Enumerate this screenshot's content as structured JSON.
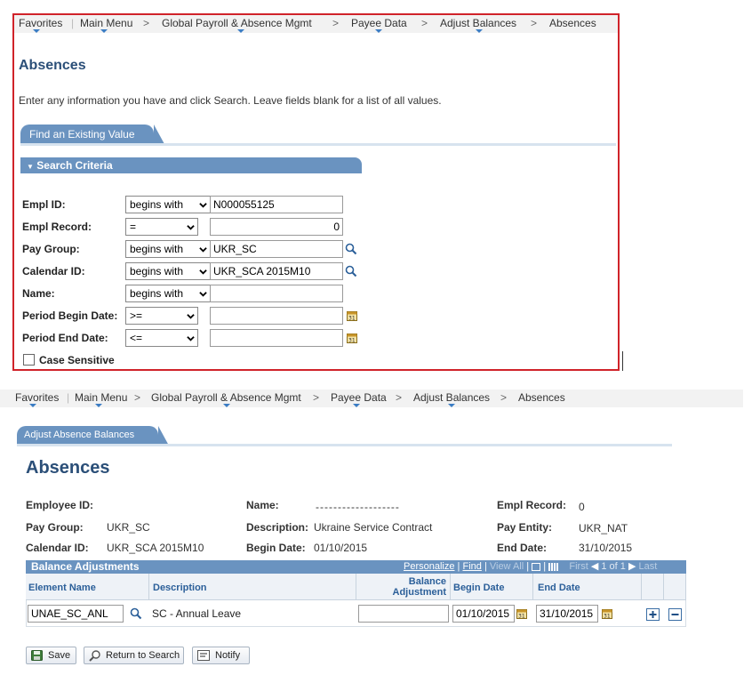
{
  "breadcrumb": {
    "favorites": "Favorites",
    "main_menu": "Main Menu",
    "global_payroll": "Global Payroll & Absence Mgmt",
    "payee_data": "Payee Data",
    "adjust_balances": "Adjust Balances",
    "absences": "Absences",
    "sep": ">"
  },
  "search_page": {
    "title": "Absences",
    "instructions": "Enter any information you have and click Search. Leave fields blank for a list of all values.",
    "tab_label": "Find an Existing Value",
    "section_label": "Search Criteria",
    "fields": {
      "empl_id": {
        "label": "Empl ID:",
        "op": "begins with",
        "value": "N000055125"
      },
      "empl_record": {
        "label": "Empl Record:",
        "op": "=",
        "value": "0"
      },
      "pay_group": {
        "label": "Pay Group:",
        "op": "begins with",
        "value": "UKR_SC"
      },
      "calendar_id": {
        "label": "Calendar ID:",
        "op": "begins with",
        "value": "UKR_SCA 2015M10"
      },
      "name": {
        "label": "Name:",
        "op": "begins with",
        "value": ""
      },
      "period_begin": {
        "label": "Period Begin Date:",
        "op": ">=",
        "value": ""
      },
      "period_end": {
        "label": "Period End Date:",
        "op": "<=",
        "value": ""
      }
    },
    "case_sensitive_label": "Case Sensitive"
  },
  "detail_page": {
    "tab_label": "Adjust Absence Balances",
    "title": "Absences",
    "header": {
      "employee_id_label": "Employee ID:",
      "employee_id_value": "",
      "name_label": "Name:",
      "name_value": "-------------------",
      "empl_record_label": "Empl Record:",
      "empl_record_value": "0",
      "pay_group_label": "Pay Group:",
      "pay_group_value": "UKR_SC",
      "description_label": "Description:",
      "description_value": "Ukraine Service Contract",
      "pay_entity_label": "Pay Entity:",
      "pay_entity_value": "UKR_NAT",
      "calendar_id_label": "Calendar ID:",
      "calendar_id_value": "UKR_SCA 2015M10",
      "begin_date_label": "Begin Date:",
      "begin_date_value": "01/10/2015",
      "end_date_label": "End Date:",
      "end_date_value": "31/10/2015"
    },
    "grid": {
      "title": "Balance Adjustments",
      "personalize": "Personalize",
      "find": "Find",
      "view_all": "View All",
      "first": "First",
      "pager": "1 of 1",
      "last": "Last",
      "pipe": "|",
      "columns": {
        "element_name": "Element Name",
        "description": "Description",
        "balance_adj_1": "Balance",
        "balance_adj_2": "Adjustment",
        "begin_date": "Begin Date",
        "end_date": "End Date"
      },
      "row": {
        "element_name": "UNAE_SC_ANL",
        "description": "SC - Annual Leave",
        "balance_adjustment": "",
        "begin_date": "01/10/2015",
        "end_date": "31/10/2015"
      }
    },
    "buttons": {
      "save": "Save",
      "return_to_search": "Return to Search",
      "notify": "Notify"
    }
  },
  "colors": {
    "accent": "#6a93c0",
    "title": "#2b4f78",
    "highlight_border": "#d0232a"
  }
}
